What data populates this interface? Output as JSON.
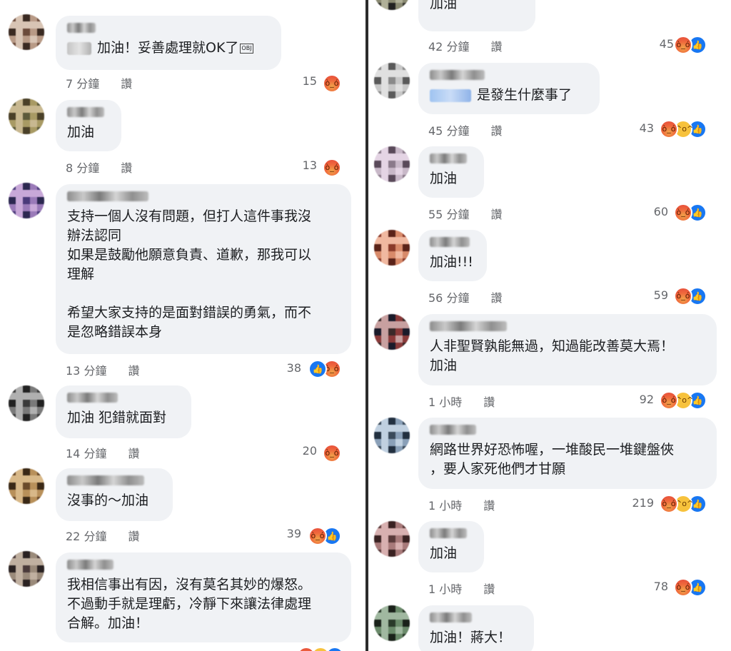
{
  "left_comments": [
    {
      "mention": true,
      "mention_style": "gray",
      "text": "加油！妥善處理就OK了",
      "obj": "OBJ",
      "time": "7 分鐘",
      "read": "讚",
      "count": "15",
      "reactions": [
        "angry"
      ]
    },
    {
      "text": "加油",
      "time": "8 分鐘",
      "read": "讚",
      "count": "13",
      "reactions": [
        "angry"
      ]
    },
    {
      "text": "支持一個人沒有問題，但打人這件事我沒\n辦法認同\n如果是鼓勵他願意負責、道歉，那我可以\n理解\n\n希望大家支持的是面對錯誤的勇氣，而不\n是忽略錯誤本身",
      "time": "13 分鐘",
      "read": "讚",
      "count": "38",
      "reactions": [
        "like",
        "angry"
      ]
    },
    {
      "text": "加油 犯錯就面對",
      "time": "14 分鐘",
      "read": "讚",
      "count": "20",
      "reactions": [
        "angry"
      ]
    },
    {
      "text": "沒事的～加油",
      "time": "22 分鐘",
      "read": "讚",
      "count": "39",
      "reactions": [
        "angry",
        "like"
      ]
    },
    {
      "text": "我相信事出有因，沒有莫名其妙的爆怒。\n不過動手就是理虧，冷靜下來讓法律處理\n合解。加油！",
      "time": "",
      "read": "",
      "count": "",
      "reactions": [
        "angry",
        "haha",
        "like"
      ]
    }
  ],
  "right_comments": [
    {
      "text": "加油",
      "time": "42 分鐘",
      "read": "讚",
      "count": "45",
      "reactions": [
        "angry",
        "like"
      ]
    },
    {
      "mention": true,
      "mention_style": "blue",
      "text": "是發生什麼事了",
      "time": "45 分鐘",
      "read": "讚",
      "count": "43",
      "reactions": [
        "angry",
        "haha",
        "like"
      ]
    },
    {
      "text": "加油",
      "time": "55 分鐘",
      "read": "讚",
      "count": "60",
      "reactions": [
        "angry",
        "like"
      ]
    },
    {
      "text": "加油!!!",
      "time": "56 分鐘",
      "read": "讚",
      "count": "59",
      "reactions": [
        "angry",
        "like"
      ]
    },
    {
      "text": "人非聖賢孰能無過，知過能改善莫大焉！\n加油",
      "time": "1 小時",
      "read": "讚",
      "count": "92",
      "reactions": [
        "angry",
        "haha",
        "like"
      ]
    },
    {
      "text": "網路世界好恐怖喔，一堆酸民一堆鍵盤俠\n，要人家死他們才甘願",
      "time": "1 小時",
      "read": "讚",
      "count": "219",
      "reactions": [
        "angry",
        "haha",
        "like"
      ]
    },
    {
      "text": "加油",
      "time": "1 小時",
      "read": "讚",
      "count": "78",
      "reactions": [
        "angry",
        "like"
      ]
    },
    {
      "text": "加油！蔣大！",
      "time": "",
      "read": "",
      "count": "",
      "reactions": []
    }
  ],
  "icons": {
    "angry": "angry-reaction-icon",
    "haha": "haha-reaction-icon",
    "like": "like-reaction-icon"
  },
  "colors": {
    "bubble": "#f0f2f5",
    "meta": "#65676b",
    "text": "#1c1e21",
    "like": "#1877f2"
  }
}
